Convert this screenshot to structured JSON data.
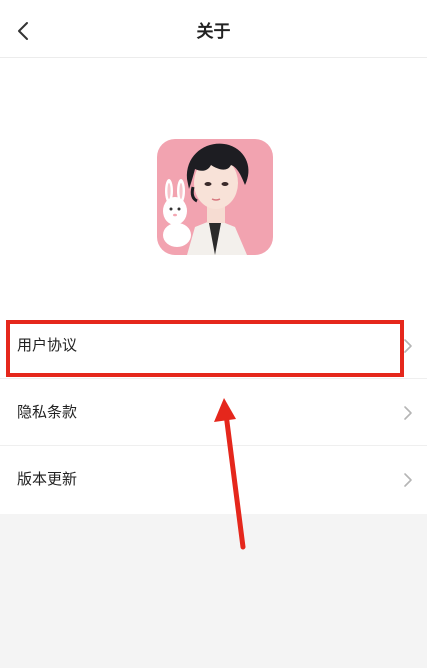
{
  "header": {
    "title": "关于",
    "back_icon": "chevron-left-icon"
  },
  "logo": {
    "description_icon": "app-logo-avatar",
    "background_color": "#f1a0ad"
  },
  "menu": {
    "items": [
      {
        "label": "用户协议",
        "icon": "chevron-right-icon"
      },
      {
        "label": "隐私条款",
        "icon": "chevron-right-icon"
      },
      {
        "label": "版本更新",
        "icon": "chevron-right-icon"
      }
    ]
  },
  "annotation": {
    "highlight_color": "#e5271c",
    "highlighted_item": "用户协议"
  }
}
